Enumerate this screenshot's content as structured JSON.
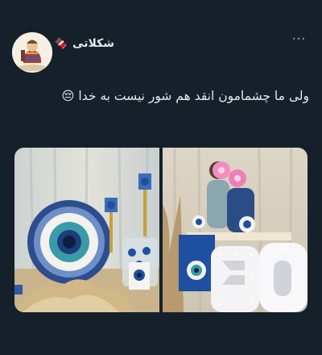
{
  "tweet": {
    "author_name": "شکلاتی",
    "author_emoji": "🍫",
    "text": "ولی ما چشمامون انقد هم شور نیست به خدا",
    "text_emoji": "😔",
    "more_label": "···"
  },
  "media": {
    "right_image_numerals": [
      "3",
      "0"
    ]
  },
  "colors": {
    "background": "#15202b",
    "text_primary": "#e7e9ea",
    "text_secondary": "#8b98a5",
    "evil_eye_blue": "#1f4fa0"
  }
}
